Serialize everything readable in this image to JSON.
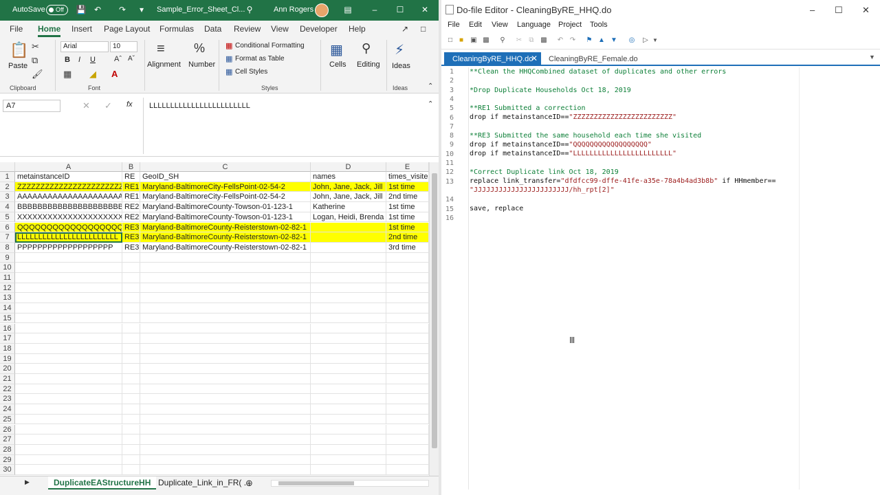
{
  "excel": {
    "autosave_label": "AutoSave",
    "autosave_state": "Off",
    "file_title": "Sample_Error_Sheet_Cl...",
    "user_name": "Ann Rogers",
    "tabs": [
      "File",
      "Home",
      "Insert",
      "Page Layout",
      "Formulas",
      "Data",
      "Review",
      "View",
      "Developer",
      "Help"
    ],
    "active_tab": "Home",
    "ribbon": {
      "paste": "Paste",
      "clipboard": "Clipboard",
      "font_name": "Arial",
      "font_size": "10",
      "font_group": "Font",
      "bold": "B",
      "italic": "I",
      "underline": "U",
      "alignment": "Alignment",
      "number": "Number",
      "conditional_formatting": "Conditional Formatting",
      "format_as_table": "Format as Table",
      "cell_styles": "Cell Styles",
      "styles_group": "Styles",
      "cells": "Cells",
      "editing": "Editing",
      "ideas": "Ideas",
      "ideas_group": "Ideas"
    },
    "name_box": "A7",
    "formula": "LLLLLLLLLLLLLLLLLLLLLLLL",
    "fx": "fx",
    "columns": [
      "A",
      "B",
      "C",
      "D",
      "E"
    ],
    "rows": [
      {
        "n": "1",
        "cells": [
          "metainstanceID",
          "RE",
          "GeoID_SH",
          "names",
          "times_visited"
        ],
        "hl": false
      },
      {
        "n": "2",
        "cells": [
          "ZZZZZZZZZZZZZZZZZZZZZZZZ",
          "RE1",
          "Maryland-BaltimoreCity-FellsPoint-02-54-2",
          "John, Jane, Jack, Jill",
          "1st time"
        ],
        "hl": true
      },
      {
        "n": "3",
        "cells": [
          "AAAAAAAAAAAAAAAAAAAAAAA",
          "RE1",
          "Maryland-BaltimoreCity-FellsPoint-02-54-2",
          "John, Jane, Jack, Jill",
          "2nd time"
        ],
        "hl": false
      },
      {
        "n": "4",
        "cells": [
          "BBBBBBBBBBBBBBBBBBBBB",
          "RE2",
          "Maryland-BaltimoreCounty-Towson-01-123-1",
          "Katherine",
          "1st time"
        ],
        "hl": false
      },
      {
        "n": "5",
        "cells": [
          "XXXXXXXXXXXXXXXXXXXXX",
          "RE2",
          "Maryland-BaltimoreCounty-Towson-01-123-1",
          "Logan, Heidi, Brenda",
          "1st time"
        ],
        "hl": false
      },
      {
        "n": "6",
        "cells": [
          "QQQQQQQQQQQQQQQQQQ",
          "RE3",
          "Maryland-BaltimoreCounty-Reisterstown-02-82-1",
          "",
          "1st time"
        ],
        "hl": true
      },
      {
        "n": "7",
        "cells": [
          "LLLLLLLLLLLLLLLLLLLLLLLL",
          "RE3",
          "Maryland-BaltimoreCounty-Reisterstown-02-82-1",
          "",
          "2nd time"
        ],
        "hl": true
      },
      {
        "n": "8",
        "cells": [
          "PPPPPPPPPPPPPPPPPPP",
          "RE3",
          "Maryland-BaltimoreCounty-Reisterstown-02-82-1",
          "",
          "3rd time"
        ],
        "hl": false
      }
    ],
    "empty_rows": [
      "9",
      "10",
      "11",
      "12",
      "13",
      "14",
      "15",
      "16",
      "17",
      "18",
      "19",
      "20",
      "21",
      "22",
      "23",
      "24",
      "25",
      "26",
      "27",
      "28",
      "29",
      "30"
    ],
    "sheet_tabs": [
      "DuplicateEAStructureHH",
      "Duplicate_Link_in_FR( ..."
    ],
    "accent": "#217346",
    "highlight": "#ffff00"
  },
  "stata": {
    "title": "Do-file Editor - CleaningByRE_HHQ.do",
    "menu": [
      "File",
      "Edit",
      "View",
      "Language",
      "Project",
      "Tools"
    ],
    "tabs": [
      "CleaningByRE_HHQ.do",
      "CleaningByRE_Female.do"
    ],
    "line_numbers": [
      "1",
      "2",
      "3",
      "4",
      "5",
      "6",
      "7",
      "8",
      "9",
      "10",
      "11",
      "12",
      "13",
      "",
      "14",
      "15",
      "16"
    ],
    "code": {
      "l1": "**Clean the HHQCombined dataset of duplicates and other errors",
      "l3": "*Drop Duplicate Households Oct 18, 2019",
      "l5": "**RE1 Submitted a correction",
      "l6a": "drop if metainstanceID==",
      "l6b": "\"ZZZZZZZZZZZZZZZZZZZZZZZZ\"",
      "l8": "**RE3 Submitted the same household each time she visited",
      "l9a": "drop if metainstanceID==",
      "l9b": "\"QQQQQQQQQQQQQQQQQQ\"",
      "l10a": "drop if metainstanceID==",
      "l10b": "\"LLLLLLLLLLLLLLLLLLLLLLLL\"",
      "l12": "*Correct Duplicate link Oct 18, 2019",
      "l13a": "replace link_transfer=",
      "l13b": "\"dfdfcc99-dffe-41fe-a35e-78a4b4ad3b8b\"",
      "l13c": " if HHmember==",
      "l13d": "\"JJJJJJJJJJJJJJJJJJJJJJJ/hh_rpt[2]\"",
      "l15": "save, replace"
    },
    "accent": "#1e6fb8"
  }
}
